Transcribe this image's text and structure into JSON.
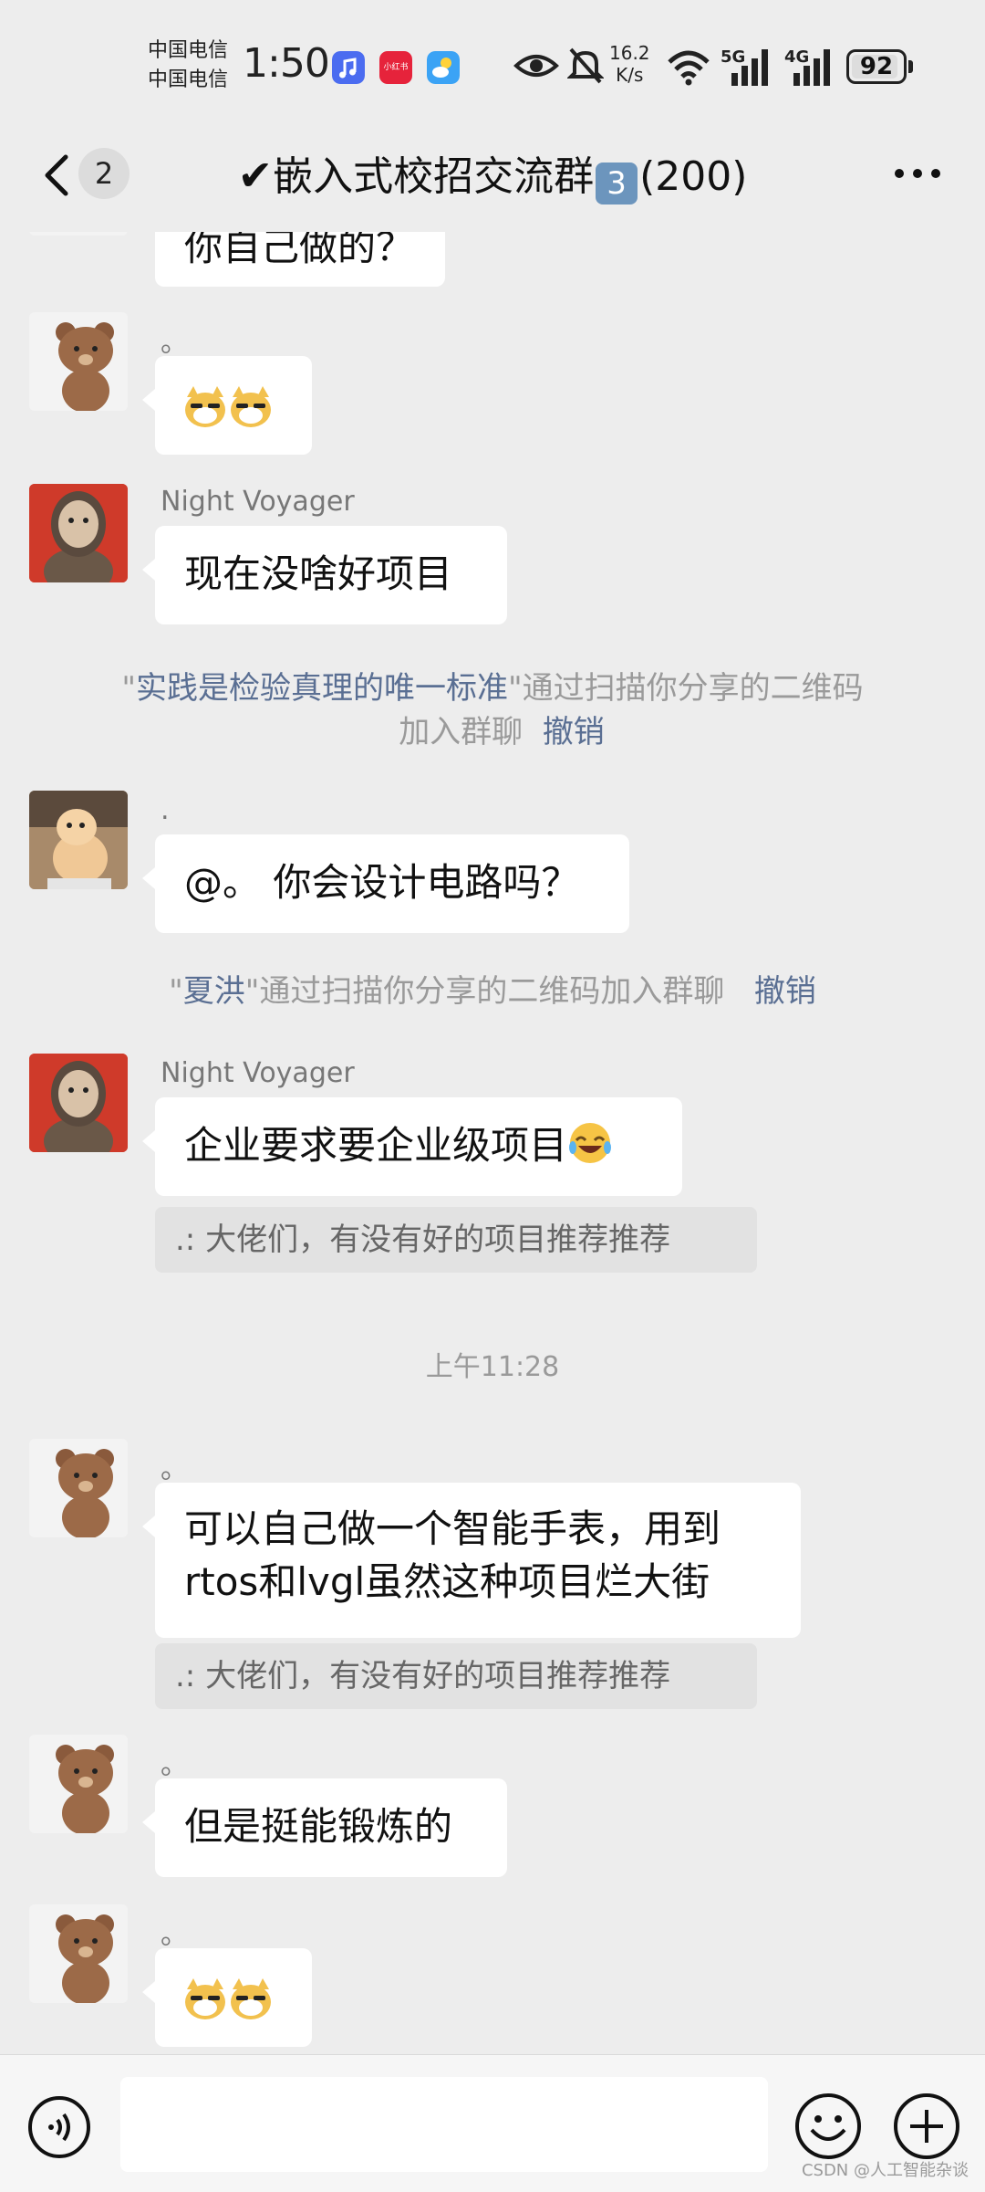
{
  "status_bar": {
    "carrier_1": "中国电信",
    "carrier_2": "中国电信",
    "time": "1:50",
    "app_icons": [
      "music-icon",
      "xiaohongshu-icon",
      "weather-icon"
    ],
    "xiaohongshu_label": "小红书",
    "net_speed_value": "16.2",
    "net_speed_unit": "K/s",
    "network_1": "5G",
    "network_2": "4G",
    "battery": "92",
    "battery_level": 0.92
  },
  "header": {
    "unread_count": "2",
    "title_prefix": "✔",
    "title_main": "嵌入式校招交流群",
    "title_badge": "3",
    "title_count": "(200)"
  },
  "messages": {
    "m0_text": "你自己做的？",
    "m1_sender": "。",
    "m2_sender": "Night Voyager",
    "m2_text": "现在没啥好项目",
    "sys1_quote_open": "\"",
    "sys1_name": "实践是检验真理的唯一标准",
    "sys1_rest": "\"通过扫描你分享的二维码",
    "sys1_line2": "加入群聊",
    "sys1_revoke": "撤销",
    "m3_sender": ".",
    "m3_text": "@。 你会设计电路吗？",
    "sys2_quote_open": "\"",
    "sys2_name": "夏洪",
    "sys2_rest": "\"通过扫描你分享的二维码加入群聊",
    "sys2_revoke": "撤销",
    "m4_sender": "Night Voyager",
    "m4_text": "企业要求要企业级项目",
    "m4_quote": ".:  大佬们，有没有好的项目推荐推荐",
    "timestamp": "上午11:28",
    "m5_sender": "。",
    "m5_line1": "可以自己做一个智能手表，用到",
    "m5_line2": "rtos和lvgl虽然这种项目烂大街",
    "m5_quote": ".:  大佬们，有没有好的项目推荐推荐",
    "m6_sender": "。",
    "m6_text": "但是挺能锻炼的",
    "m7_sender": "。"
  },
  "input": {
    "placeholder": ""
  },
  "watermark": "CSDN @人工智能杂谈",
  "colors": {
    "background": "#ededed",
    "bubble": "#ffffff",
    "link": "#5a6f93",
    "system_text": "#9a9a9a"
  }
}
